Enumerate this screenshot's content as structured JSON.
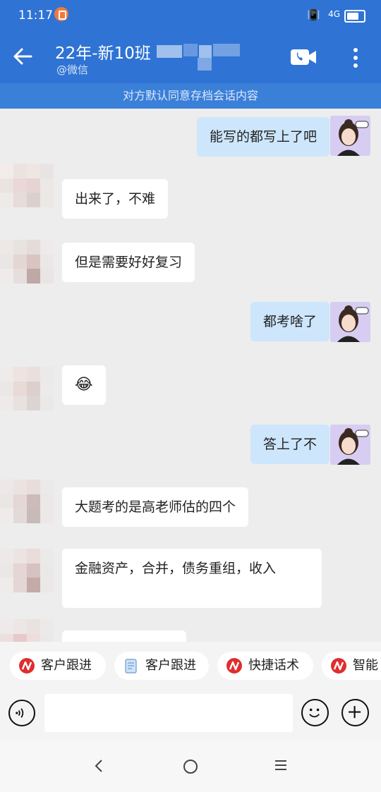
{
  "status": {
    "time": "11:17",
    "signal": "4G"
  },
  "header": {
    "title": "22年-新10班",
    "subtitle": "@微信"
  },
  "notice": "对方默认同意存档会话内容",
  "messages": [
    {
      "side": "right",
      "text": "能写的都写上了吧"
    },
    {
      "side": "left",
      "text": "出来了，不难"
    },
    {
      "side": "left",
      "text": "但是需要好好复习"
    },
    {
      "side": "right",
      "text": "都考啥了"
    },
    {
      "side": "left",
      "text": "😂"
    },
    {
      "side": "right",
      "text": "答上了不"
    },
    {
      "side": "left",
      "text": "大题考的是高老师估的四个"
    },
    {
      "side": "left",
      "text": "金融资产，合并，债务重组，收入"
    }
  ],
  "quick_actions": [
    {
      "label": "客户跟进",
      "icon": "red-logo-icon"
    },
    {
      "label": "客户跟进",
      "icon": "notepad-icon"
    },
    {
      "label": "快捷话术",
      "icon": "red-logo-icon"
    },
    {
      "label": "智能",
      "icon": "red-logo-icon"
    }
  ],
  "input": {
    "placeholder": ""
  },
  "colors": {
    "header": "#2f73d4",
    "notice": "#3a7fd8",
    "bubble_out": "#cde6fb",
    "bubble_in": "#ffffff",
    "chat_bg": "#ededed"
  }
}
